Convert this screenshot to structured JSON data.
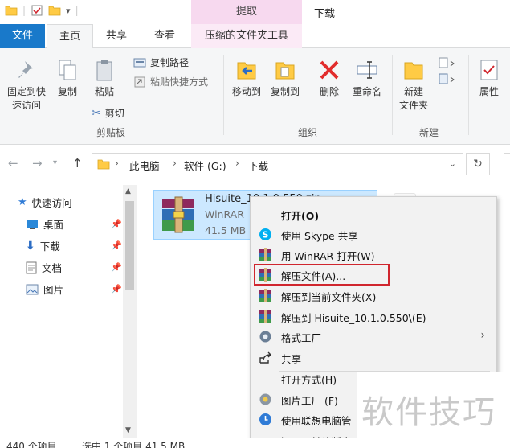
{
  "window": {
    "title": "下载",
    "context_tab_group": "提取"
  },
  "tabs": {
    "file": "文件",
    "home": "主页",
    "share": "共享",
    "view": "查看",
    "compressed_tools": "压缩的文件夹工具"
  },
  "ribbon": {
    "pin_quick_access": [
      "固定到快",
      "速访问"
    ],
    "copy": "复制",
    "paste": "粘贴",
    "copy_path": "复制路径",
    "paste_shortcut": "粘贴快捷方式",
    "cut": "剪切",
    "group_clipboard": "剪贴板",
    "move_to": "移动到",
    "copy_to": "复制到",
    "delete": "删除",
    "rename": "重命名",
    "group_organize": "组织",
    "new_folder": [
      "新建",
      "文件夹"
    ],
    "group_new": "新建",
    "properties": "属性"
  },
  "address": {
    "crumbs": [
      "此电脑",
      "软件 (G:)",
      "下载"
    ]
  },
  "nav": {
    "items": [
      {
        "label": "快速访问",
        "pinned": false
      },
      {
        "label": "桌面",
        "pinned": true
      },
      {
        "label": "下载",
        "pinned": true
      },
      {
        "label": "文档",
        "pinned": true
      },
      {
        "label": "图片",
        "pinned": true
      }
    ]
  },
  "file": {
    "name": "Hisuite_10.1.0.550.zip",
    "type": "WinRAR",
    "size": "41.5 MB"
  },
  "context_menu": {
    "open": "打开(O)",
    "skype_share": "使用 Skype 共享",
    "open_winrar": "用 WinRAR 打开(W)",
    "extract_files": "解压文件(A)...",
    "extract_here": "解压到当前文件夹(X)",
    "extract_to": "解压到 Hisuite_10.1.0.550\\(E)",
    "format_factory": "格式工厂",
    "share": "共享",
    "open_with": "打开方式(H)",
    "picture_factory": "图片工厂 (F)",
    "lenovo_manager": "使用联想电脑管",
    "restore_previous": "还原以前的版本"
  },
  "status": {
    "item_count": "440 个项目",
    "selected": "选中 1 个项目 41.5 MB"
  },
  "watermark": "软件技巧",
  "colors": {
    "file_tab": "#1979ca",
    "context_tab": "#f7d9ef",
    "selection": "#cce8ff",
    "highlight_border": "#d0262e",
    "folder": "#ffcb45"
  }
}
